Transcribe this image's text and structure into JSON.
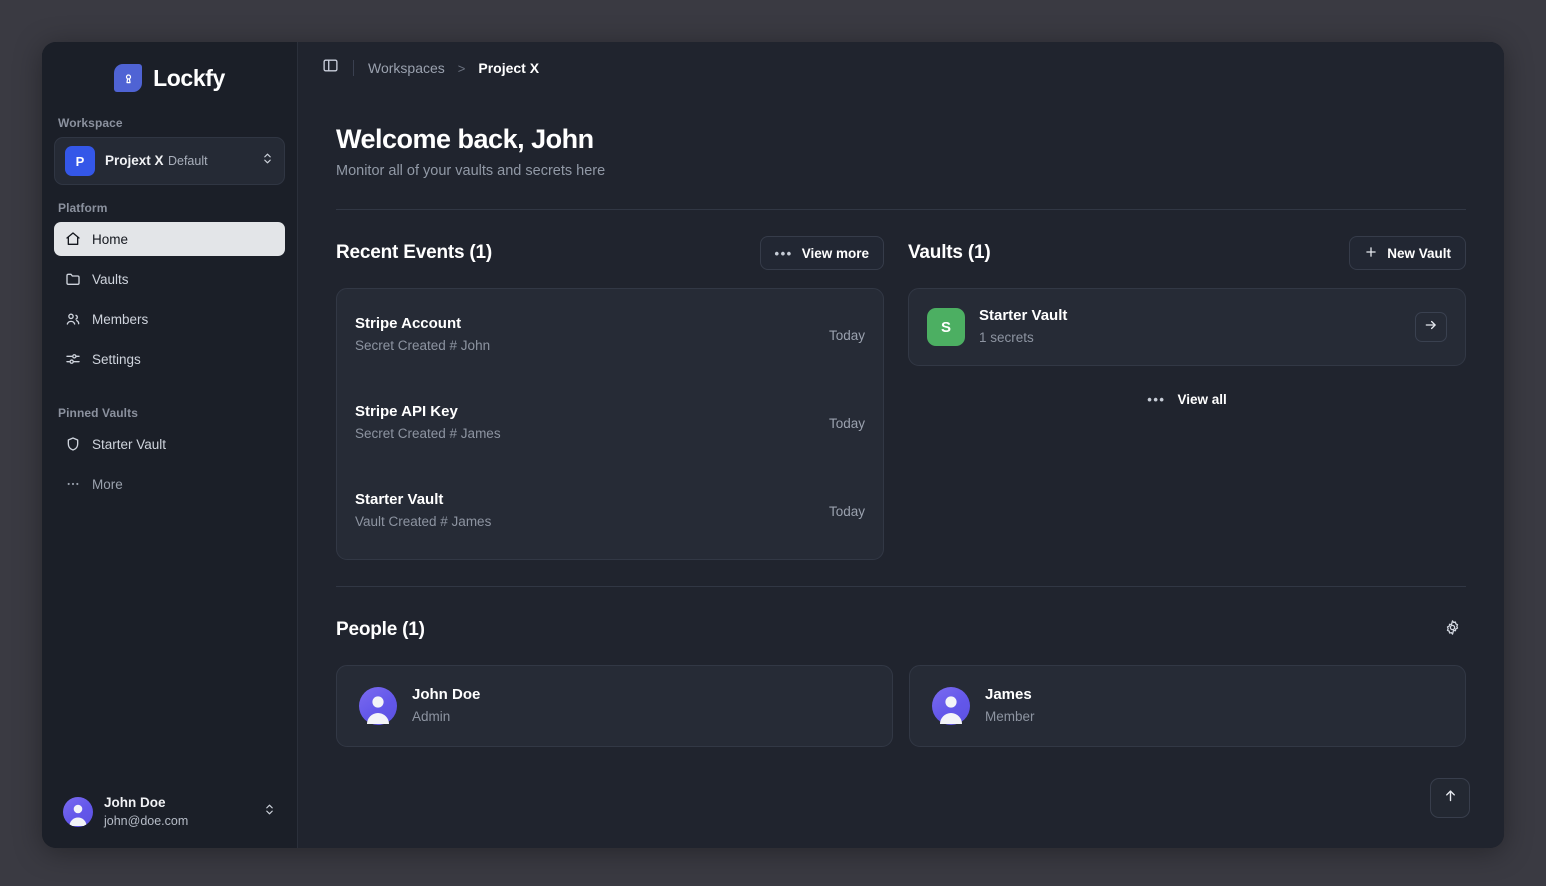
{
  "brand": {
    "name": "Lockfy",
    "logo_icon": "lock-keyhole-leaf-icon",
    "accent": "#4f63d4"
  },
  "sidebar": {
    "workspace_label": "Workspace",
    "workspace": {
      "badge": "P",
      "badge_color": "#3457e8",
      "name": "Projext X",
      "subtitle": "Default",
      "chevron_icon": "chevrons-up-down-icon"
    },
    "platform_label": "Platform",
    "nav": [
      {
        "label": "Home",
        "icon": "home-icon",
        "active": true
      },
      {
        "label": "Vaults",
        "icon": "folder-icon",
        "active": false
      },
      {
        "label": "Members",
        "icon": "users-icon",
        "active": false
      },
      {
        "label": "Settings",
        "icon": "sliders-icon",
        "active": false
      }
    ],
    "pinned_label": "Pinned Vaults",
    "pinned": [
      {
        "label": "Starter Vault",
        "icon": "shield-icon"
      },
      {
        "label": "More",
        "icon": "ellipsis-icon"
      }
    ],
    "user": {
      "name": "John Doe",
      "email": "john@doe.com",
      "avatar_icon": "user-avatar",
      "chevron_icon": "chevrons-up-down-icon"
    }
  },
  "topbar": {
    "toggle_icon": "panel-left-icon",
    "breadcrumb": {
      "root": "Workspaces",
      "separator": ">",
      "current": "Project X"
    }
  },
  "welcome": {
    "title": "Welcome back, John",
    "subtitle": "Monitor all of your vaults and secrets here"
  },
  "events_section": {
    "title": "Recent Events (1)",
    "view_more_label": "View more",
    "view_more_icon": "ellipsis-icon",
    "items": [
      {
        "name": "Stripe Account",
        "meta": "Secret Created # John",
        "time": "Today"
      },
      {
        "name": "Stripe API Key",
        "meta": "Secret Created # James",
        "time": "Today"
      },
      {
        "name": "Starter Vault",
        "meta": "Vault Created # James",
        "time": "Today"
      }
    ]
  },
  "vaults_section": {
    "title": "Vaults (1)",
    "new_vault_label": "New Vault",
    "new_vault_icon": "plus-icon",
    "view_all_label": "View all",
    "view_all_icon": "ellipsis-icon",
    "items": [
      {
        "badge": "S",
        "badge_color": "#4caf62",
        "name": "Starter Vault",
        "subtitle": "1 secrets",
        "open_icon": "arrow-right-icon"
      }
    ]
  },
  "people_section": {
    "title": "People (1)",
    "settings_icon": "gear-icon",
    "items": [
      {
        "name": "John Doe",
        "role": "Admin",
        "avatar_icon": "user-avatar"
      },
      {
        "name": "James",
        "role": "Member",
        "avatar_icon": "user-avatar"
      }
    ]
  },
  "scroll_top": {
    "icon": "arrow-up-icon"
  }
}
